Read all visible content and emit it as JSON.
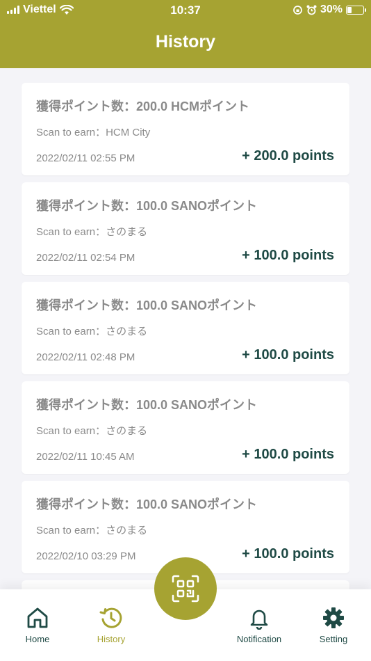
{
  "status": {
    "carrier": "Viettel",
    "time": "10:37",
    "battery_percent": "30%",
    "battery_level": 0.3
  },
  "header": {
    "title": "History"
  },
  "colors": {
    "brand": "#a6a332",
    "points": "#1f4a45",
    "muted": "#8a8a8a"
  },
  "history": [
    {
      "title": "獲得ポイント数：200.0 HCMポイント",
      "source_label": "Scan to earn：",
      "source": "HCM City",
      "date": "2022/02/11 02:55 PM",
      "points": "+ 200.0 points"
    },
    {
      "title": "獲得ポイント数：100.0 SANOポイント",
      "source_label": "Scan to earn：",
      "source": "さのまる",
      "date": "2022/02/11 02:54 PM",
      "points": "+ 100.0 points"
    },
    {
      "title": "獲得ポイント数：100.0 SANOポイント",
      "source_label": "Scan to earn：",
      "source": "さのまる",
      "date": "2022/02/11 02:48 PM",
      "points": "+ 100.0 points"
    },
    {
      "title": "獲得ポイント数：100.0 SANOポイント",
      "source_label": "Scan to earn：",
      "source": "さのまる",
      "date": "2022/02/11 10:45 AM",
      "points": "+ 100.0 points"
    },
    {
      "title": "獲得ポイント数：100.0 SANOポイント",
      "source_label": "Scan to earn：",
      "source": "さのまる",
      "date": "2022/02/10 03:29 PM",
      "points": "+ 100.0 points"
    }
  ],
  "tabs": {
    "home": "Home",
    "history": "History",
    "notification": "Notification",
    "setting": "Setting"
  },
  "icons": {
    "home": "home-icon",
    "history": "history-icon",
    "scan": "qr-scan-icon",
    "notification": "bell-icon",
    "setting": "gear-icon"
  }
}
